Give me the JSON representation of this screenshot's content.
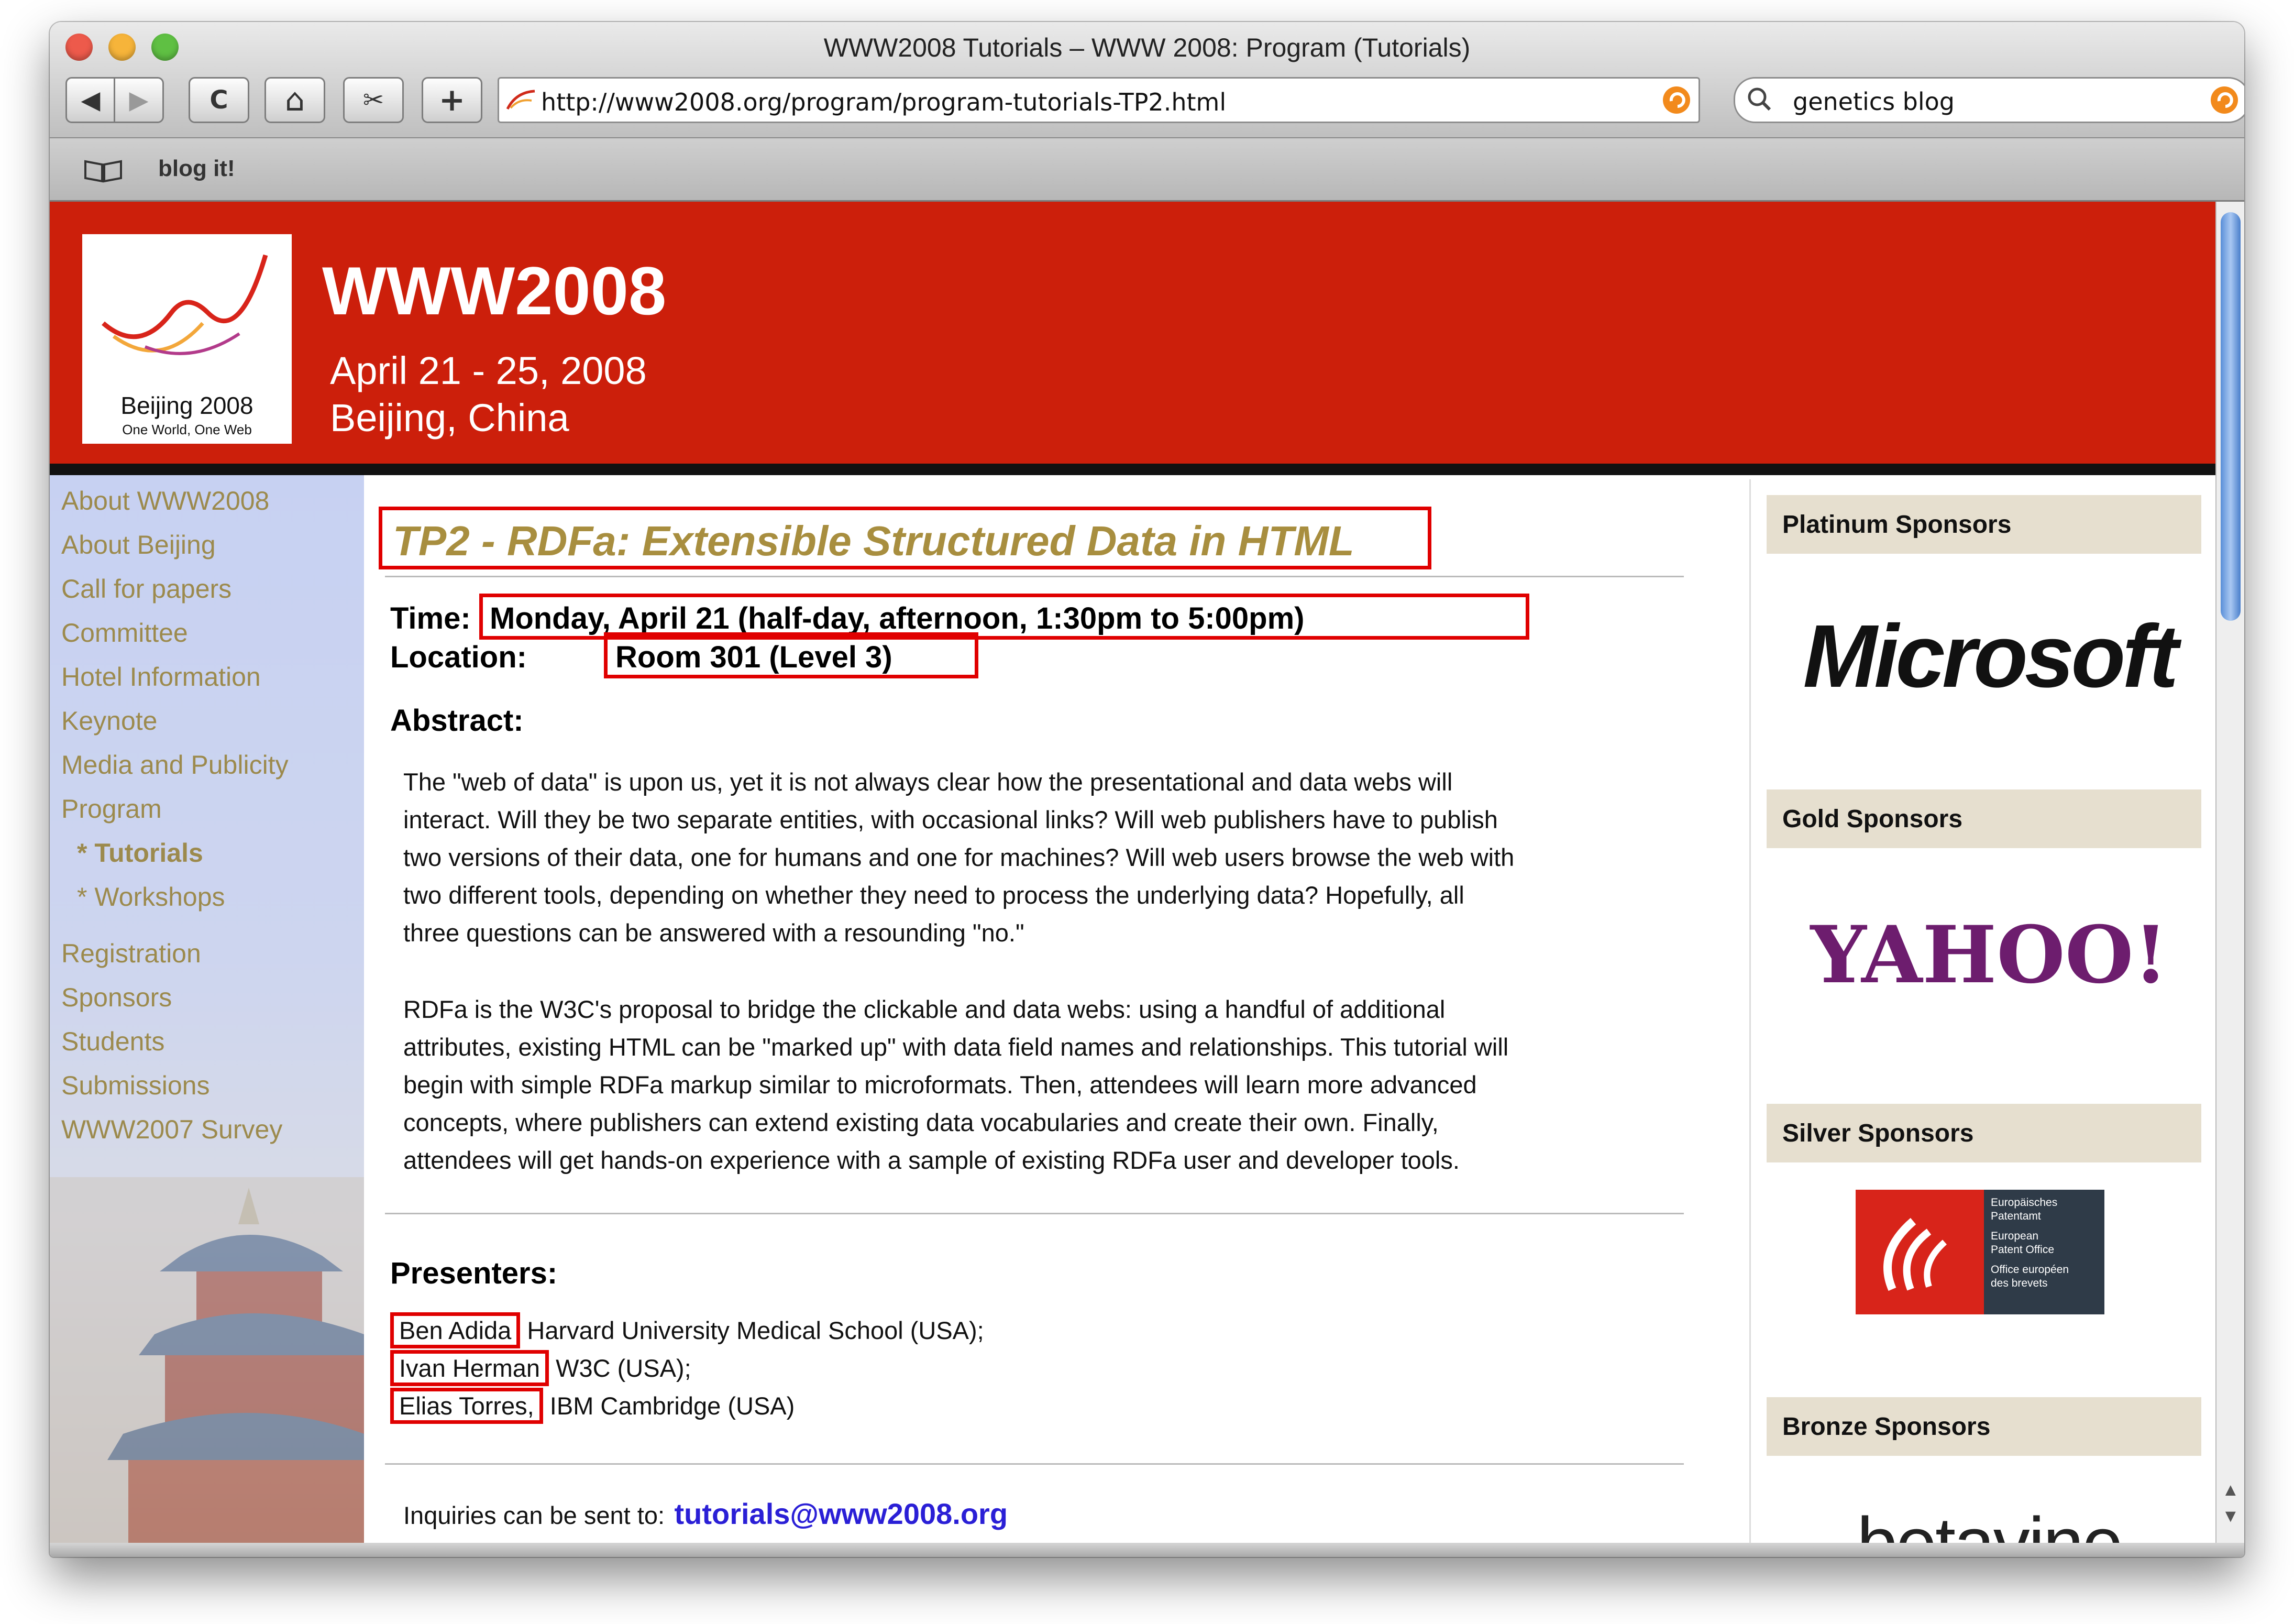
{
  "window": {
    "title": "WWW2008 Tutorials – WWW 2008: Program (Tutorials)",
    "url": "http://www2008.org/program/program-tutorials-TP2.html",
    "search_value": "genetics blog",
    "bookmark_label": "blog it!",
    "traffic_colors": [
      "#ed5a4b",
      "#f6b43a",
      "#5fc043"
    ]
  },
  "toolbar": {
    "back_icon": "◀",
    "forward_icon": "▶",
    "reload_icon": "C",
    "home_icon": "⌂",
    "snap_icon": "✂",
    "add_icon": "+"
  },
  "banner": {
    "title": "WWW2008",
    "dates": "April 21 - 25, 2008",
    "place": "Beijing, China",
    "logo_caption": "Beijing 2008",
    "logo_tagline": "One World, One Web",
    "color": "#cc1f0b"
  },
  "sidebar": {
    "items": [
      "About WWW2008",
      "About Beijing",
      "Call for papers",
      "Committee",
      "Hotel Information",
      "Keynote",
      "Media and Publicity",
      "Program",
      "* Tutorials",
      "* Workshops",
      "Registration",
      "Sponsors",
      "Students",
      "Submissions",
      "WWW2007 Survey"
    ]
  },
  "tutorial": {
    "title": "TP2 - RDFa: Extensible Structured Data in HTML",
    "time_label": "Time:",
    "time_value": "Monday, April 21 (half-day, afternoon, 1:30pm to 5:00pm)",
    "location_label": "Location:",
    "location_value": "Room 301 (Level 3)",
    "abstract_heading": "Abstract:",
    "abstract_lines_1": [
      "The \"web of data\" is upon us, yet it is not always clear how the presentational and data webs will",
      "interact. Will they be two separate entities, with occasional links? Will web publishers have to publish",
      "two versions of their data, one for humans and one for machines? Will web users browse the web with",
      "two different tools, depending on whether they need to process the underlying data? Hopefully, all",
      "three questions can be answered with a resounding \"no.\""
    ],
    "abstract_lines_2": [
      "RDFa is the W3C's proposal to bridge the clickable and data webs: using a handful of additional",
      "attributes, existing HTML can be \"marked up\" with data field names and relationships. This tutorial will",
      "begin with simple RDFa markup similar to microformats. Then, attendees will learn more advanced",
      "concepts, where publishers can extend existing data vocabularies and create their own. Finally,",
      "attendees will get hands-on experience with a sample of existing RDFa user and developer tools."
    ],
    "presenters_heading": "Presenters:",
    "presenters": [
      {
        "name": "Ben Adida",
        "affil": "Harvard University Medical School (USA);"
      },
      {
        "name": "Ivan Herman",
        "affil": "W3C (USA);"
      },
      {
        "name": "Elias Torres,",
        "affil": "IBM Cambridge (USA)"
      }
    ],
    "inquiries_label": "Inquiries can be sent to:",
    "inquiries_email": "tutorials@www2008.org"
  },
  "sponsors": {
    "platinum_label": "Platinum Sponsors",
    "platinum_logo": "Microsoft",
    "gold_label": "Gold Sponsors",
    "gold_logo": "YAHOO!",
    "silver_label": "Silver Sponsors",
    "silver_logo_lines": [
      "Europäisches",
      "Patentamt",
      "European",
      "Patent Office",
      "Office européen",
      "des brevets"
    ],
    "bronze_label": "Bronze Sponsors",
    "bronze_logo": "betavine"
  }
}
